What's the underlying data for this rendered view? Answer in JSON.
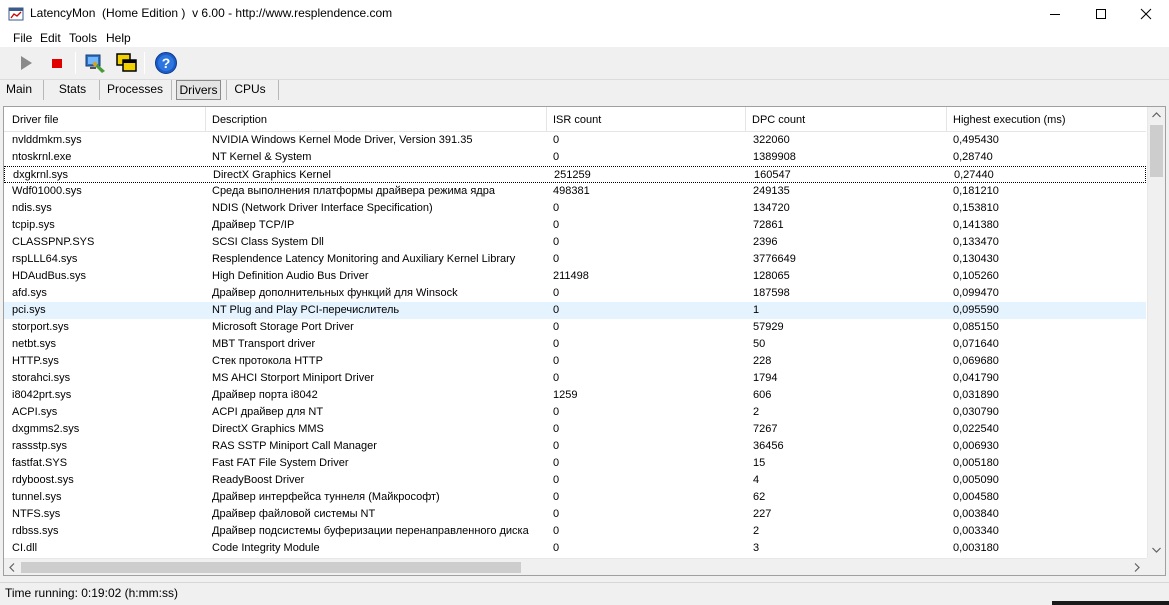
{
  "window": {
    "title": "LatencyMon  (Home Edition )  v 6.00 - http://www.resplendence.com",
    "minimize_glyph": "minimize-icon",
    "maximize_glyph": "maximize-icon",
    "close_glyph": "close-icon"
  },
  "menu": {
    "items": [
      "File",
      "Edit",
      "Tools",
      "Help"
    ]
  },
  "toolbar": {
    "buttons": [
      "play-icon",
      "stop-icon",
      "monitor-settings-icon",
      "windows-icon",
      "help-icon"
    ]
  },
  "tabs": {
    "items": [
      "Main",
      "Stats",
      "Processes",
      "Drivers",
      "CPUs"
    ],
    "active": "Drivers"
  },
  "table": {
    "columns": [
      "Driver file",
      "Description",
      "ISR count",
      "DPC count",
      "Highest execution (ms)"
    ],
    "rows": [
      [
        "nvlddmkm.sys",
        "NVIDIA Windows Kernel Mode Driver, Version 391.35",
        "0",
        "322060",
        "0,495430"
      ],
      [
        "ntoskrnl.exe",
        "NT Kernel & System",
        "0",
        "1389908",
        "0,28740"
      ],
      [
        "dxgkrnl.sys",
        "DirectX Graphics Kernel",
        "251259",
        "160547",
        "0,27440"
      ],
      [
        "Wdf01000.sys",
        "Среда выполнения платформы драйвера режима ядра",
        "498381",
        "249135",
        "0,181210"
      ],
      [
        "ndis.sys",
        "NDIS (Network Driver Interface Specification)",
        "0",
        "134720",
        "0,153810"
      ],
      [
        "tcpip.sys",
        "Драйвер TCP/IP",
        "0",
        "72861",
        "0,141380"
      ],
      [
        "CLASSPNP.SYS",
        "SCSI Class System Dll",
        "0",
        "2396",
        "0,133470"
      ],
      [
        "rspLLL64.sys",
        "Resplendence Latency Monitoring and Auxiliary Kernel Library",
        "0",
        "3776649",
        "0,130430"
      ],
      [
        "HDAudBus.sys",
        "High Definition Audio Bus Driver",
        "211498",
        "128065",
        "0,105260"
      ],
      [
        "afd.sys",
        "Драйвер дополнительных функций для Winsock",
        "0",
        "187598",
        "0,099470"
      ],
      [
        "pci.sys",
        "NT Plug and Play PCI-перечислитель",
        "0",
        "1",
        "0,095590"
      ],
      [
        "storport.sys",
        "Microsoft Storage Port Driver",
        "0",
        "57929",
        "0,085150"
      ],
      [
        "netbt.sys",
        "MBT Transport driver",
        "0",
        "50",
        "0,071640"
      ],
      [
        "HTTP.sys",
        "Стек протокола HTTP",
        "0",
        "228",
        "0,069680"
      ],
      [
        "storahci.sys",
        "MS AHCI Storport Miniport Driver",
        "0",
        "1794",
        "0,041790"
      ],
      [
        "i8042prt.sys",
        "Драйвер порта i8042",
        "1259",
        "606",
        "0,031890"
      ],
      [
        "ACPI.sys",
        "ACPI драйвер для NT",
        "0",
        "2",
        "0,030790"
      ],
      [
        "dxgmms2.sys",
        "DirectX Graphics MMS",
        "0",
        "7267",
        "0,022540"
      ],
      [
        "rassstp.sys",
        "RAS SSTP Miniport Call Manager",
        "0",
        "36456",
        "0,006930"
      ],
      [
        "fastfat.SYS",
        "Fast FAT File System Driver",
        "0",
        "15",
        "0,005180"
      ],
      [
        "rdyboost.sys",
        "ReadyBoost Driver",
        "0",
        "4",
        "0,005090"
      ],
      [
        "tunnel.sys",
        "Драйвер интерфейса туннеля (Майкрософт)",
        "0",
        "62",
        "0,004580"
      ],
      [
        "NTFS.sys",
        "Драйвер файловой системы NT",
        "0",
        "227",
        "0,003840"
      ],
      [
        "rdbss.sys",
        "Драйвер подсистемы буферизации перенаправленного диска",
        "0",
        "2",
        "0,003340"
      ],
      [
        "CI.dll",
        "Code Integrity Module",
        "0",
        "3",
        "0,003180"
      ]
    ],
    "hover_row": "pci.sys",
    "focus_row": "dxgkrnl.sys"
  },
  "status": {
    "text": "Time running: 0:19:02  (h:mm:ss)"
  }
}
